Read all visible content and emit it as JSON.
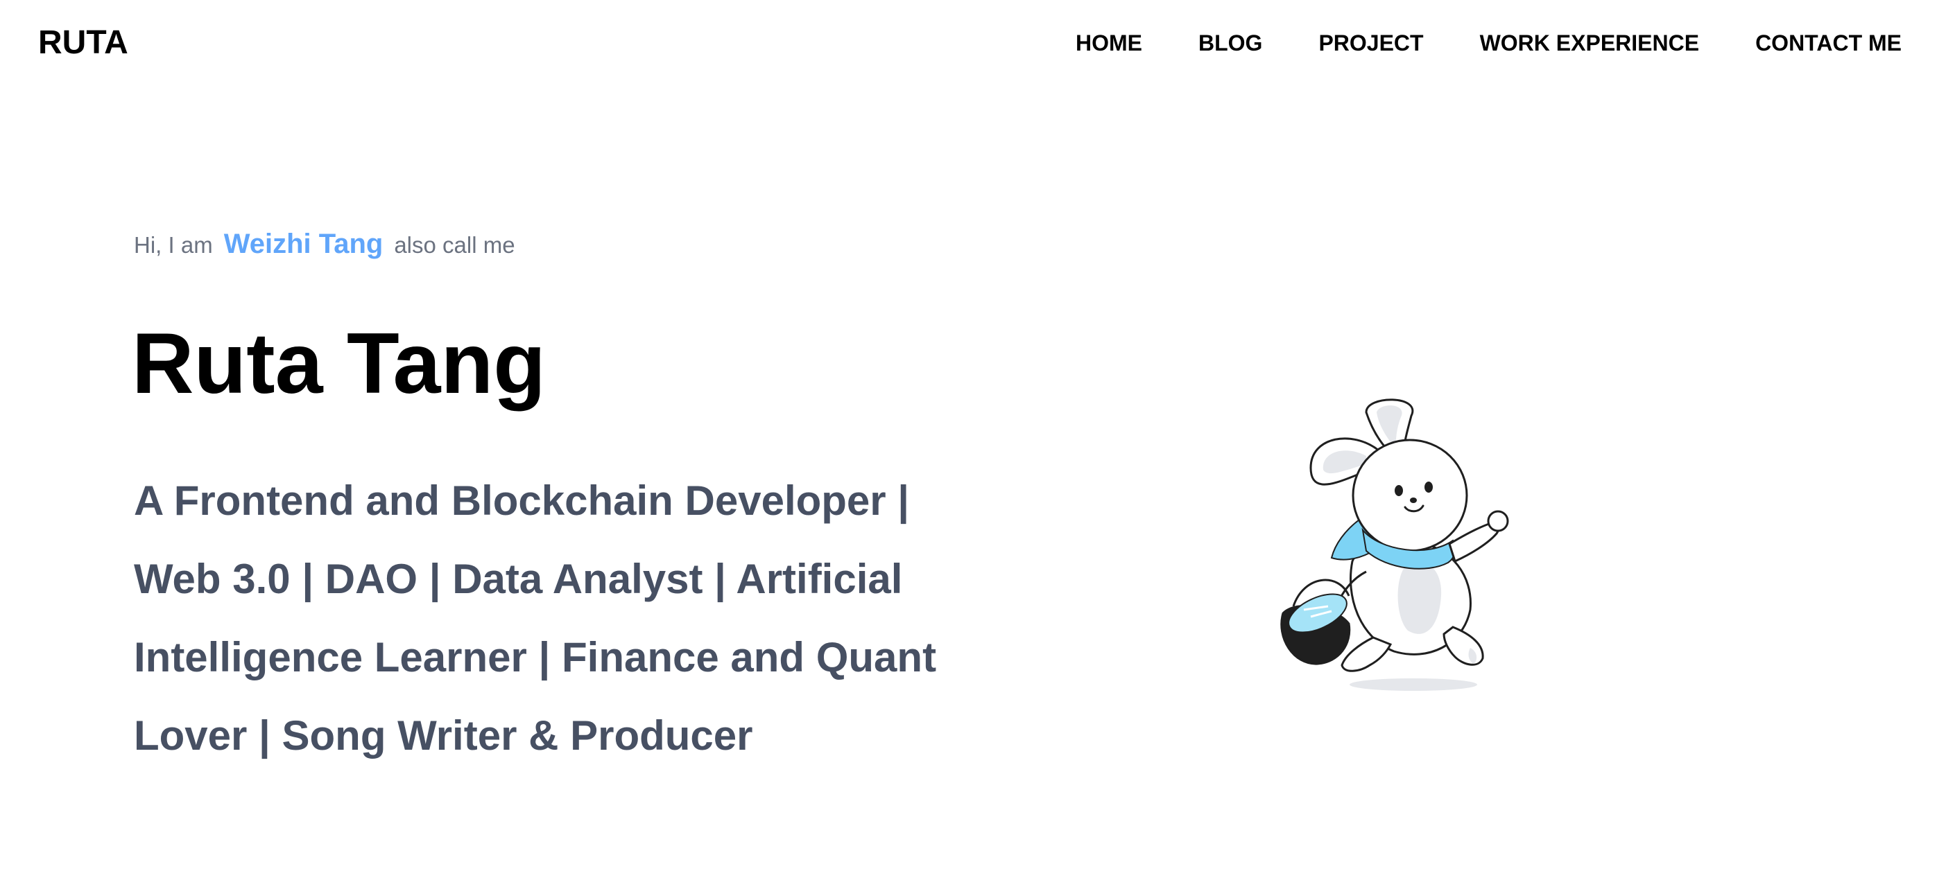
{
  "header": {
    "logo": "RUTA",
    "nav": [
      {
        "label": "HOME"
      },
      {
        "label": "BLOG"
      },
      {
        "label": "PROJECT"
      },
      {
        "label": "WORK EXPERIENCE"
      },
      {
        "label": "CONTACT ME"
      }
    ]
  },
  "hero": {
    "greeting_prefix": "Hi, I am",
    "name": "Weizhi Tang",
    "greeting_suffix": "also call me",
    "title": "Ruta Tang",
    "tagline": "A Frontend and Blockchain Developer | Web 3.0 | DAO | Data Analyst | Artificial Intelligence Learner | Finance and Quant Lover | Song Writer & Producer"
  },
  "illustration": {
    "icon": "running-bunny-with-easter-basket",
    "colors": {
      "scarf": "#7dd3f5",
      "basket": "#1f1f1f",
      "body_shade": "#e5e7eb"
    }
  },
  "colors": {
    "accent": "#60a5fa",
    "tagline": "#475063",
    "muted": "#6b7280"
  }
}
